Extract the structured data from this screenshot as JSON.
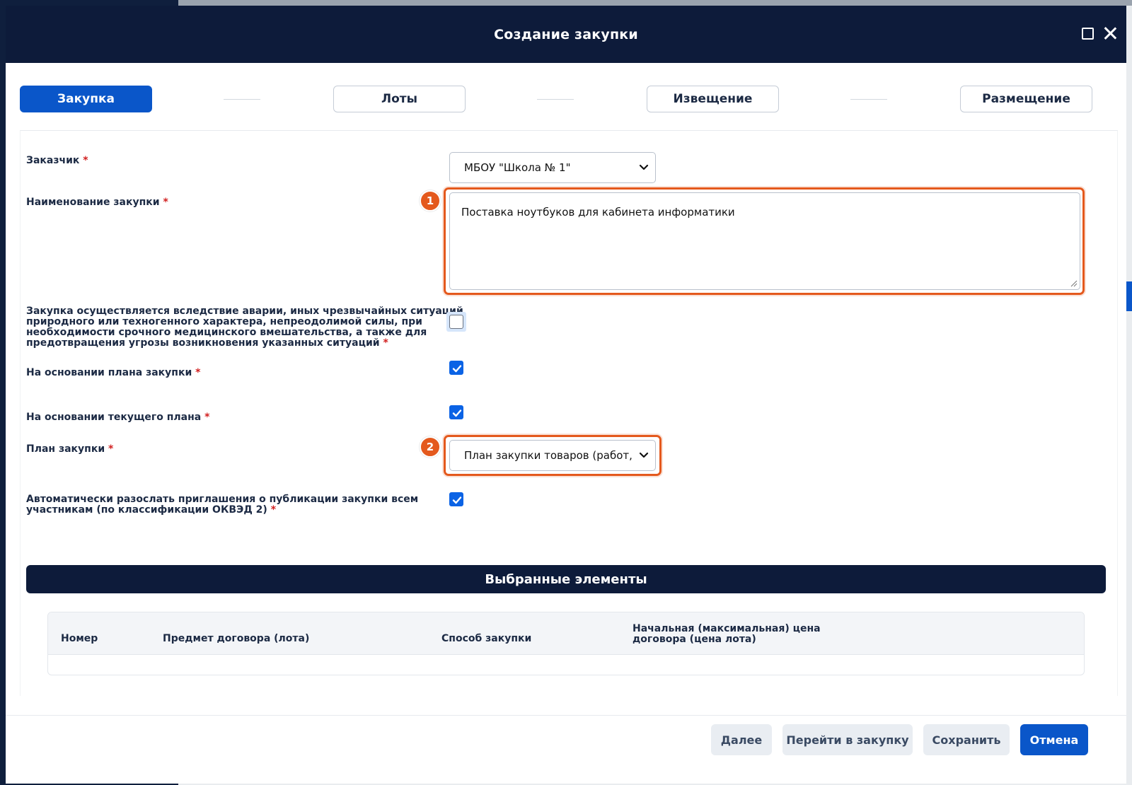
{
  "modal": {
    "title": "Создание закупки"
  },
  "stepper": {
    "steps": [
      {
        "label": "Закупка",
        "active": true
      },
      {
        "label": "Лоты",
        "active": false
      },
      {
        "label": "Извещение",
        "active": false
      },
      {
        "label": "Размещение",
        "active": false
      }
    ]
  },
  "form": {
    "customer": {
      "label": "Заказчик",
      "required_mark": "*",
      "value": "МБОУ \"Школа № 1\""
    },
    "name": {
      "label": "Наименование закупки",
      "required_mark": "*",
      "value": "Поставка ноутбуков для кабинета информатики",
      "badge": "1"
    },
    "emergency": {
      "label_lines": [
        "Закупка осуществляется вследствие аварии, иных чрезвычайных ситуаций",
        "природного или техногенного характера, непреодолимой силы, при",
        "необходимости срочного медицинского вмешательства, а также для",
        "предотвращения угрозы возникновения указанных ситуаций"
      ],
      "required_mark": "*",
      "checked": false
    },
    "based_on_plan": {
      "label": "На основании плана закупки",
      "required_mark": "*",
      "checked": true
    },
    "based_on_current_plan": {
      "label": "На основании текущего плана",
      "required_mark": "*",
      "checked": true
    },
    "plan": {
      "label": "План закупки",
      "required_mark": "*",
      "value": "План закупки товаров (работ,",
      "badge": "2"
    },
    "auto_invite": {
      "label_lines": [
        "Автоматически разослать приглашения о публикации закупки всем",
        "участникам (по классификации ОКВЭД 2)"
      ],
      "required_mark": "*",
      "checked": true
    }
  },
  "selected": {
    "title": "Выбранные элементы",
    "columns": [
      "Номер",
      "Предмет договора (лота)",
      "Способ закупки",
      "Начальная (максимальная) цена",
      "договора (цена лота)"
    ]
  },
  "footer": {
    "next_label": "Далее",
    "goto_label": "Перейти в закупку",
    "save_label": "Сохранить",
    "cancel_label": "Отмена"
  },
  "colors": {
    "header_bg": "#0d1b3a",
    "accent": "#0a56c9",
    "highlight": "#e4591d",
    "required": "#d11f1f"
  }
}
